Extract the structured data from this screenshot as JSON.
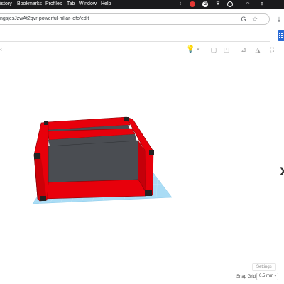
{
  "menubar": {
    "items": [
      "istory",
      "Bookmarks",
      "Profiles",
      "Tab",
      "Window",
      "Help"
    ]
  },
  "browser": {
    "url": "ngsjesJzwAt2qvr-powerful-hillar-jofo/edit"
  },
  "editor": {
    "settings_label": "Settings",
    "snap_grid_label": "Snap Grid",
    "snap_grid_value": "0.5 mm"
  },
  "colors": {
    "box_red": "#e8000b",
    "inner_gray": "#4a4d52",
    "grid_blue": "#9fd6f2",
    "sidebar_blue": "#2a6bd6"
  },
  "icons": {
    "menubar_status": [
      "bluetooth-icon",
      "record-icon",
      "google-icon",
      "vpn-icon",
      "profile-icon",
      "wifi-icon",
      "control-center-icon"
    ],
    "toolbar": [
      "lightbulb-icon",
      "group-icon",
      "ungroup-icon",
      "align-icon",
      "mirror-icon",
      "cruise-icon"
    ]
  }
}
